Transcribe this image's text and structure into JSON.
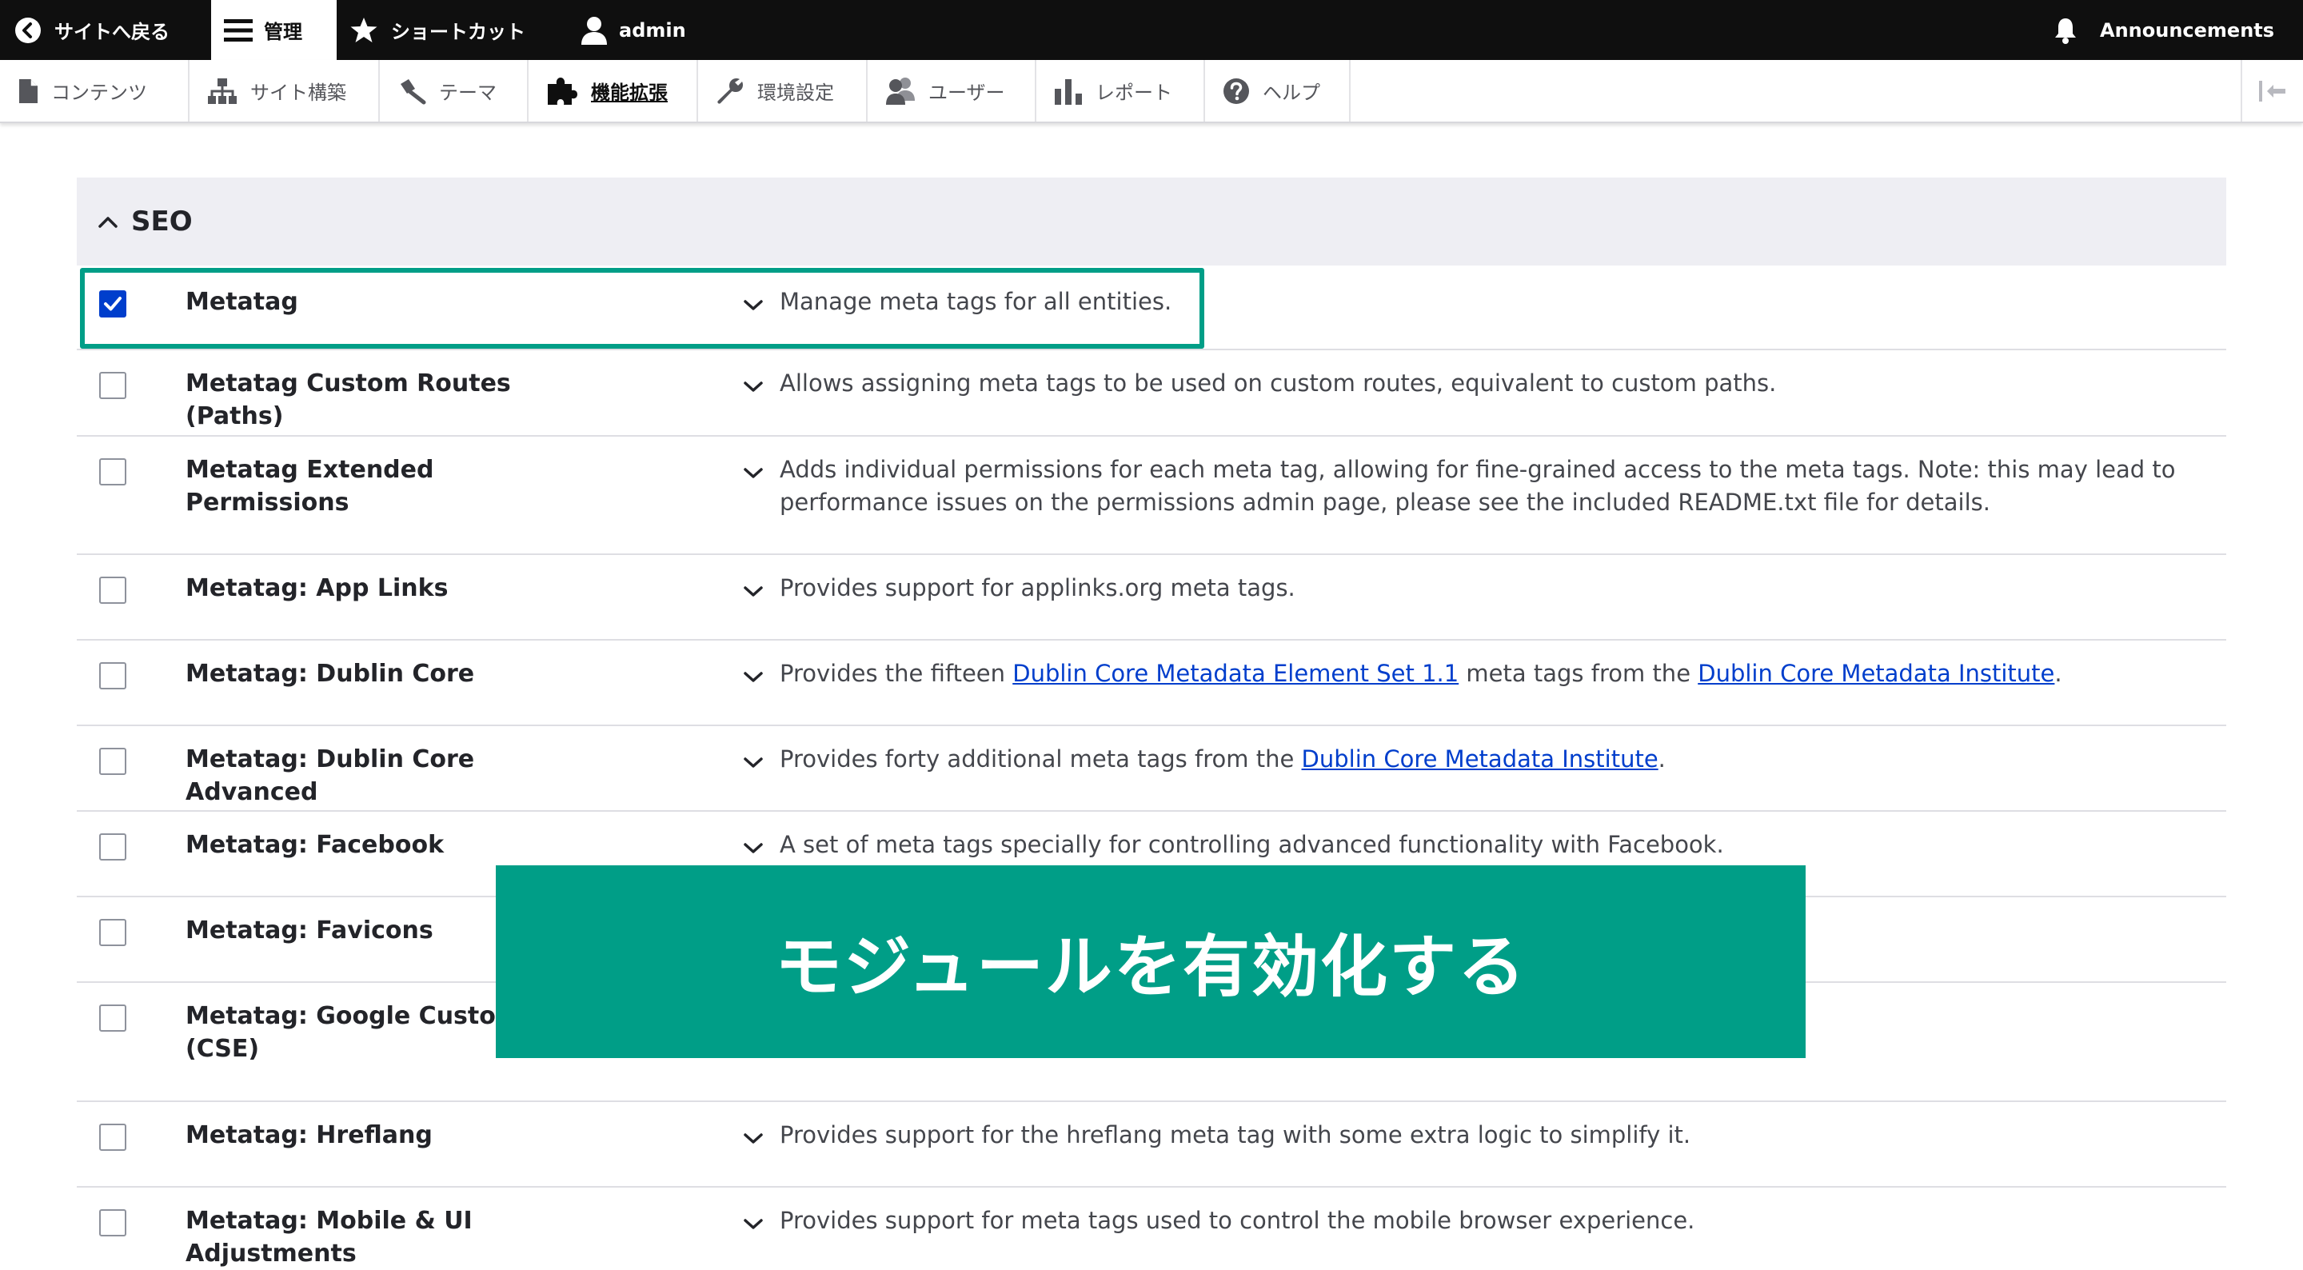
{
  "toolbar": {
    "back_to_site": "サイトへ戻る",
    "manage": "管理",
    "shortcuts": "ショートカット",
    "user": "admin",
    "announcements": "Announcements"
  },
  "tray": {
    "items": [
      {
        "label": "コンテンツ",
        "icon": "file-icon"
      },
      {
        "label": "サイト構築",
        "icon": "sitemap-icon"
      },
      {
        "label": "テーマ",
        "icon": "paintbrush-icon"
      },
      {
        "label": "機能拡張",
        "icon": "puzzle-icon",
        "active": true
      },
      {
        "label": "環境設定",
        "icon": "wrench-icon"
      },
      {
        "label": "ユーザー",
        "icon": "people-icon"
      },
      {
        "label": "レポート",
        "icon": "bar-chart-icon"
      },
      {
        "label": "ヘルプ",
        "icon": "help-icon"
      }
    ]
  },
  "section": {
    "title": "SEO"
  },
  "modules": [
    {
      "name": "Metatag",
      "checked": true,
      "desc_parts": [
        "Manage meta tags for all entities."
      ]
    },
    {
      "name": "Metatag Custom Routes (Paths)",
      "checked": false,
      "desc_parts": [
        "Allows assigning meta tags to be used on custom routes, equivalent to custom paths."
      ]
    },
    {
      "name": "Metatag Extended Permissions",
      "checked": false,
      "desc_parts": [
        "Adds individual permissions for each meta tag, allowing for fine-grained access to the meta tags. Note: this may lead to performance issues on the permissions admin page, please see the included README.txt file for details."
      ]
    },
    {
      "name": "Metatag: App Links",
      "checked": false,
      "desc_parts": [
        "Provides support for applinks.org meta tags."
      ]
    },
    {
      "name": "Metatag: Dublin Core",
      "checked": false,
      "desc_parts": [
        "Provides the fifteen ",
        "Dublin Core Metadata Element Set 1.1",
        " meta tags from the ",
        "Dublin Core Metadata Institute",
        "."
      ]
    },
    {
      "name": "Metatag: Dublin Core Advanced",
      "checked": false,
      "desc_parts": [
        "Provides forty additional meta tags from the ",
        "Dublin Core Metadata Institute",
        "."
      ]
    },
    {
      "name": "Metatag: Facebook",
      "checked": false,
      "desc_parts": [
        "A set of meta tags specially for controlling advanced functionality with Facebook."
      ]
    },
    {
      "name": "Metatag: Favicons",
      "checked": false,
      "desc_parts": [
        ""
      ]
    },
    {
      "name": "Metatag: Google Custom (CSE)",
      "checked": false,
      "desc_parts": [
        ""
      ]
    },
    {
      "name": "Metatag: Hreflang",
      "checked": false,
      "desc_parts": [
        "Provides support for the hreflang meta tag with some extra logic to simplify it."
      ]
    },
    {
      "name": "Metatag: Mobile & UI Adjustments",
      "checked": false,
      "desc_parts": [
        "Provides support for meta tags used to control the mobile browser experience."
      ]
    }
  ],
  "overlay": {
    "banner_text": "モジュールを有効化する"
  },
  "colors": {
    "toolbar_bg": "#0f0f0f",
    "accent_teal": "#009e87",
    "link_blue": "#003ecc",
    "section_bg": "#eeeef3"
  }
}
